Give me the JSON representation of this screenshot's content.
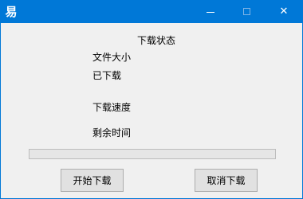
{
  "window": {
    "app_icon": "易",
    "controls": {
      "minimize_icon": "minimize-icon",
      "maximize_icon": "maximize-icon",
      "close_icon": "close-icon",
      "close_glyph": "✕"
    },
    "accent_color": "#0078d7"
  },
  "status": {
    "title": "下载状态",
    "file_size_label": "文件大小",
    "downloaded_label": "已下载",
    "speed_label": "下载速度",
    "remaining_label": "剩余时间"
  },
  "progress": {
    "value_percent": 0
  },
  "buttons": {
    "start_label": "开始下载",
    "cancel_label": "取消下载"
  }
}
